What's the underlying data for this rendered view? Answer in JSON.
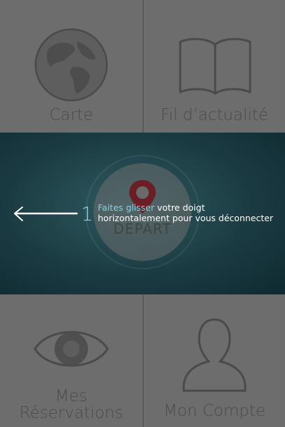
{
  "tiles": {
    "map": {
      "label": "Carte",
      "icon": "globe-icon"
    },
    "news": {
      "label": "Fil d’actualité",
      "icon": "open-book-icon"
    },
    "reservations": {
      "label_line1": "Mes",
      "label_line2": "Réservations",
      "icon": "eye-icon"
    },
    "account": {
      "label": "Mon Compte",
      "icon": "user-icon"
    }
  },
  "depart": {
    "label": "DEPART",
    "icon": "location-pin-icon"
  },
  "onboarding": {
    "step": "1",
    "highlight": "Faites glisser",
    "text_rest": " votre doigt",
    "text_line2": "horizontalement pour vous déconnecter",
    "arrow_icon": "swipe-left-arrow-icon"
  },
  "colors": {
    "highlight": "#7fd6e6",
    "pin": "#7a1f28",
    "band": "#1b3b42",
    "tile": "#6d6d6d"
  }
}
